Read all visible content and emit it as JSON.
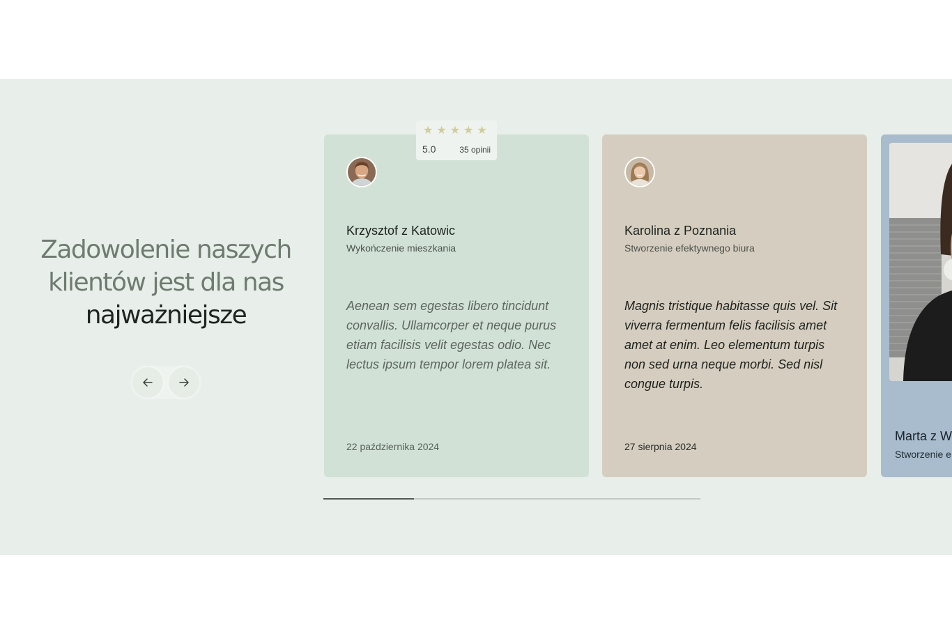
{
  "heading": {
    "line1": "Zadowolenie naszych",
    "line2": "klientów jest dla nas",
    "line3": "najważniejsze"
  },
  "nav": {
    "prev_icon": "arrow-left-icon",
    "next_icon": "arrow-right-icon"
  },
  "rating": {
    "stars": 5,
    "star_color": "#cfcca0",
    "score": "5.0",
    "count": "35 opinii"
  },
  "testimonials": [
    {
      "name": "Krzysztof z Katowic",
      "service": "Wykończenie mieszkania",
      "quote": "Aenean sem egestas libero tincidunt convallis. Ullamcorper et neque purus etiam facilisis velit egestas odio. Nec lectus ipsum tempor lorem platea sit.",
      "date": "22 października 2024",
      "bg": "#d1e1d6"
    },
    {
      "name": "Karolina z Poznania",
      "service": "Stworzenie efektywnego biura",
      "quote": "Magnis tristique habitasse quis vel. Sit viverra fermentum felis facilisis amet amet at enim. Leo elementum turpis non sed urna neque morbi. Sed nisl congue turpis.",
      "date": "27 sierpnia 2024",
      "bg": "#d5cdbf"
    },
    {
      "name": "Marta z W",
      "service": "Stworzenie e",
      "type": "video",
      "bg": "#a9bccd"
    }
  ],
  "progress": {
    "fraction": 0.24
  }
}
